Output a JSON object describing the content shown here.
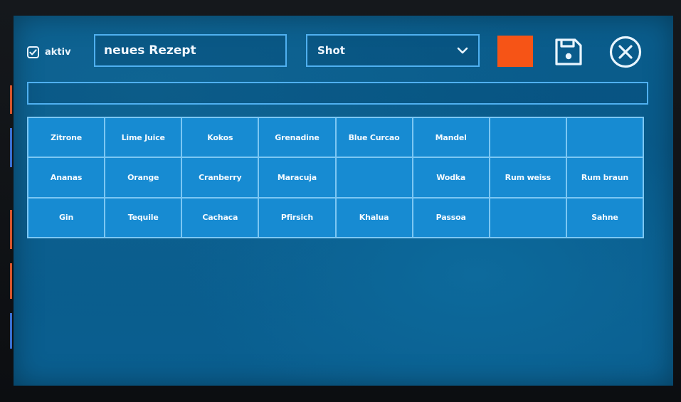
{
  "header": {
    "active_label": "aktiv",
    "active_checked": true,
    "recipe_name": "neues Rezept",
    "category_selected": "Shot",
    "color_value": "#f65416",
    "save_icon": "save-icon",
    "close_icon": "close-circle-icon"
  },
  "steps_field": {
    "value": ""
  },
  "ingredients": {
    "rows": [
      [
        "Zitrone",
        "Lime Juice",
        "Kokos",
        "Grenadine",
        "Blue Curcao",
        "Mandel",
        "",
        ""
      ],
      [
        "Ananas",
        "Orange",
        "Cranberry",
        "Maracuja",
        "",
        "Wodka",
        "Rum weiss",
        "Rum braun"
      ],
      [
        "Gin",
        "Tequile",
        "Cachaca",
        "Pfirsich",
        "Khalua",
        "Passoa",
        "",
        "Sahne"
      ]
    ]
  },
  "colors": {
    "screen_bg": "#0a5d8c",
    "border": "#4fb0f0",
    "cell_bg": "#178bd2",
    "grid_line": "#7cc7f3",
    "accent": "#f65416"
  }
}
